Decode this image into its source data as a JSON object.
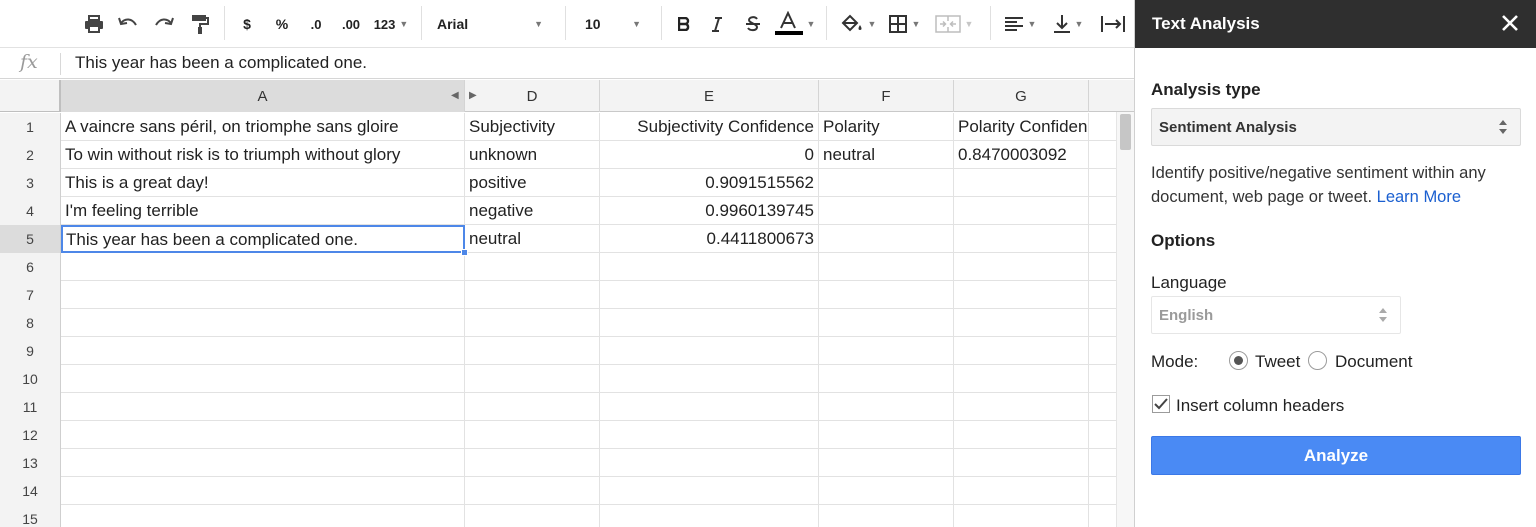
{
  "toolbar": {
    "dollar_label": "$",
    "percent_label": "%",
    "dec_decrease_label": ".0",
    "dec_increase_label": ".00",
    "more_formats_label": "123",
    "font_family": "Arial",
    "font_size": "10"
  },
  "formula_bar": {
    "fx_label": "fx",
    "value": "This year has been a complicated one."
  },
  "grid": {
    "columns": [
      "A",
      "D",
      "E",
      "F",
      "G"
    ],
    "row_numbers": [
      "1",
      "2",
      "3",
      "4",
      "5",
      "6",
      "7",
      "8",
      "9",
      "10",
      "11",
      "12",
      "13",
      "14",
      "15"
    ],
    "rows": [
      [
        "A vaincre sans péril, on triomphe sans gloire",
        "Subjectivity",
        "Subjectivity Confidence",
        "Polarity",
        "Polarity Confidence"
      ],
      [
        "To win without risk is to triumph without glory",
        "unknown",
        "0",
        "neutral",
        "0.8470003092"
      ],
      [
        "This is a great day!",
        "positive",
        "0.9091515562",
        "",
        ""
      ],
      [
        "I'm feeling terrible",
        "negative",
        "0.9960139745",
        "",
        ""
      ],
      [
        "This year has been a complicated one.",
        "neutral",
        "0.4411800673",
        "",
        ""
      ],
      [
        "",
        "",
        "",
        "",
        ""
      ],
      [
        "",
        "",
        "",
        "",
        ""
      ],
      [
        "",
        "",
        "",
        "",
        ""
      ],
      [
        "",
        "",
        "",
        "",
        ""
      ],
      [
        "",
        "",
        "",
        "",
        ""
      ],
      [
        "",
        "",
        "",
        "",
        ""
      ],
      [
        "",
        "",
        "",
        "",
        ""
      ],
      [
        "",
        "",
        "",
        "",
        ""
      ],
      [
        "",
        "",
        "",
        "",
        ""
      ],
      [
        "",
        "",
        "",
        "",
        ""
      ]
    ],
    "active_cell": "A5"
  },
  "sidebar": {
    "title": "Text Analysis",
    "analysis_type_label": "Analysis type",
    "analysis_type_value": "Sentiment Analysis",
    "description": "Identify positive/negative sentiment within any document, web page or tweet.",
    "learn_more": "Learn More",
    "options_label": "Options",
    "language_label": "Language",
    "language_value": "English",
    "mode_label": "Mode:",
    "mode_tweet": "Tweet",
    "mode_document": "Document",
    "mode_selected": "Tweet",
    "insert_headers_label": "Insert column headers",
    "insert_headers_checked": true,
    "analyze_button": "Analyze",
    "link_color": "#1a5fd0",
    "button_color": "#4a8af4"
  }
}
